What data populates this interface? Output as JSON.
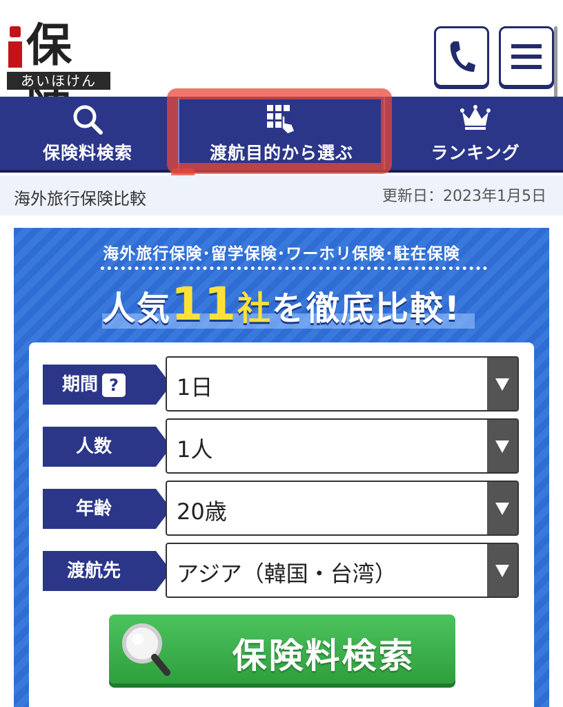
{
  "header": {
    "logo_title": "保険",
    "logo_sub": "あいほけん"
  },
  "nav": [
    {
      "label": "保険料検索",
      "icon": "search-icon"
    },
    {
      "label": "渡航目的から選ぶ",
      "icon": "grid-hand-icon"
    },
    {
      "label": "ランキング",
      "icon": "crown-icon"
    }
  ],
  "subheader": {
    "title": "海外旅行保険比較",
    "date": "更新日：2023年1月5日"
  },
  "panel": {
    "tagline": "海外旅行保険･留学保険･ワーホリ保険･駐在保険",
    "head_pre": "人気",
    "head_num": "11",
    "head_sha": "社",
    "head_post": "を徹底比較!"
  },
  "form": {
    "rows": [
      {
        "label": "期間",
        "value": "1日",
        "help": "?"
      },
      {
        "label": "人数",
        "value": "1人"
      },
      {
        "label": "年齢",
        "value": "20歳"
      },
      {
        "label": "渡航先",
        "value": "アジア（韓国・台湾）"
      }
    ],
    "submit_label": "保険料検索"
  },
  "colors": {
    "nav_bg": "#2b3688",
    "brand_red": "#c3131a",
    "panel_blue": "#2f6dd4",
    "submit_green": "#3fb24f",
    "highlight": "#e84838"
  }
}
